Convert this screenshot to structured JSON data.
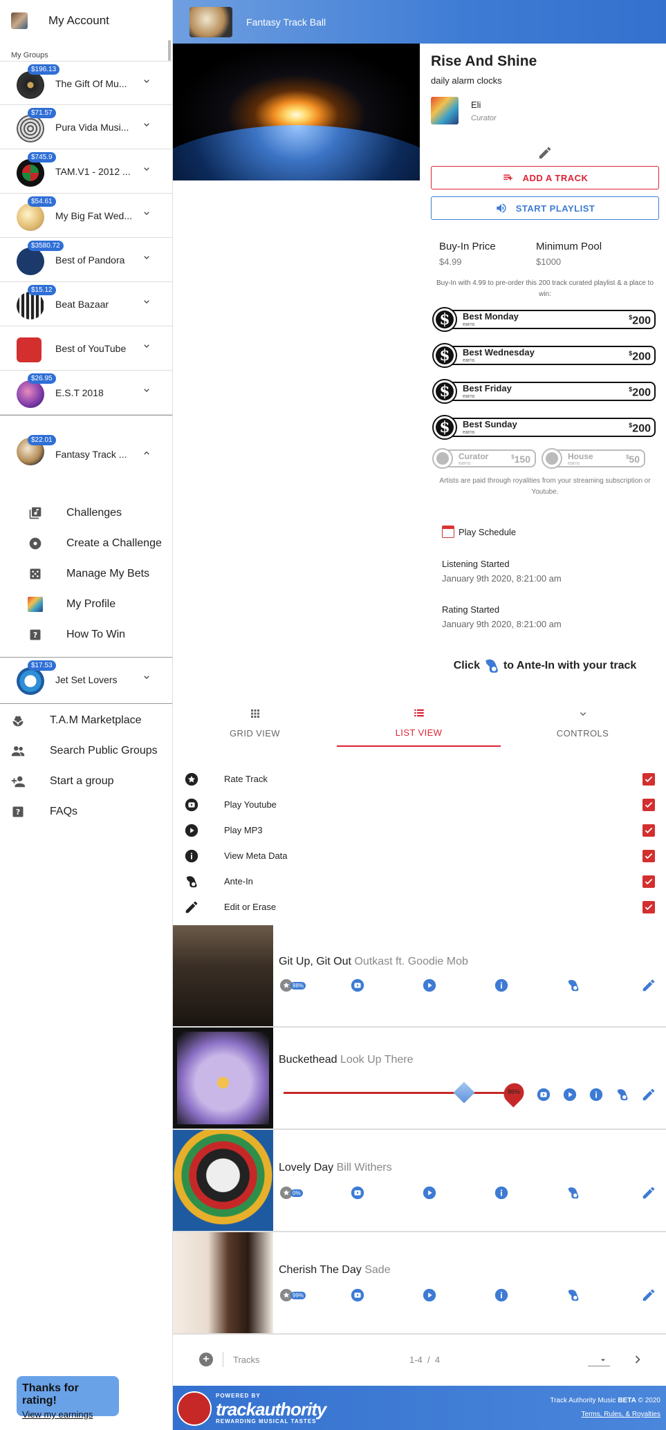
{
  "account": {
    "label": "My Account"
  },
  "sidebar": {
    "groups_heading": "My Groups",
    "groups": [
      {
        "name": "The Gift Of Mu...",
        "badge": "$196.13"
      },
      {
        "name": "Pura Vida Musi...",
        "badge": "$71.57"
      },
      {
        "name": "TAM.V1 - 2012 ...",
        "badge": "$745.9"
      },
      {
        "name": "My Big Fat Wed...",
        "badge": "$54.61"
      },
      {
        "name": "Best of Pandora",
        "badge": "$3580.72"
      },
      {
        "name": "Beat Bazaar",
        "badge": "$15.12"
      },
      {
        "name": "Best of YouTube",
        "badge": ""
      },
      {
        "name": "E.S.T 2018",
        "badge": "$26.95"
      }
    ],
    "open_group": {
      "name": "Fantasy Track ...",
      "badge": "$22.01"
    },
    "submenu": [
      {
        "label": "Challenges",
        "icon": "library-music-icon"
      },
      {
        "label": "Create a Challenge",
        "icon": "disc-icon"
      },
      {
        "label": "Manage My Bets",
        "icon": "dice-icon"
      },
      {
        "label": "My Profile",
        "icon": "profile-photo-icon"
      },
      {
        "label": "How To Win",
        "icon": "help-box-icon"
      }
    ],
    "last_group": {
      "name": "Jet Set Lovers",
      "badge": "$17.53"
    },
    "nav": [
      {
        "label": "T.A.M Marketplace",
        "icon": "marketplace-icon"
      },
      {
        "label": "Search Public Groups",
        "icon": "people-icon"
      },
      {
        "label": "Start a group",
        "icon": "person-add-icon"
      },
      {
        "label": "FAQs",
        "icon": "help-box-icon"
      }
    ],
    "toast": {
      "title": "Thanks for rating!",
      "link": "View my earnings"
    }
  },
  "header": {
    "title": "Fantasy Track Ball"
  },
  "playlist": {
    "title": "Rise And Shine",
    "subtitle": "daily alarm clocks",
    "curator_name": "Eli",
    "curator_role": "Curator",
    "add_track": "ADD A TRACK",
    "start_playlist": "START PLAYLIST",
    "buy_in_label": "Buy-In Price",
    "buy_in_value": "$4.99",
    "min_pool_label": "Minimum Pool",
    "min_pool_value": "$1000",
    "buy_in_text": "Buy-In with 4.99 to pre-order this 200 track curated playlist & a place to win:",
    "prizes": [
      {
        "name": "Best Monday",
        "sub": "earns",
        "amount": "200",
        "currency": "$"
      },
      {
        "name": "Best Wednesday",
        "sub": "earns",
        "amount": "200",
        "currency": "$"
      },
      {
        "name": "Best Friday",
        "sub": "earns",
        "amount": "200",
        "currency": "$"
      },
      {
        "name": "Best Sunday",
        "sub": "earns",
        "amount": "200",
        "currency": "$"
      }
    ],
    "small_prizes": [
      {
        "name": "Curator",
        "sub": "earns",
        "amount": "150",
        "currency": "$"
      },
      {
        "name": "House",
        "sub": "earns",
        "amount": "50",
        "currency": "$"
      }
    ],
    "artists_note": "Artists are paid through royalities from your streaming subscription or Youtube.",
    "schedule_heading": "Play Schedule",
    "listening_label": "Listening Started",
    "listening_date": "January 9th 2020, 8:21:00 am",
    "rating_label": "Rating Started",
    "rating_date": "January 9th 2020, 8:21:00 am",
    "ante_prefix": "Click",
    "ante_suffix": "to Ante-In with your track"
  },
  "tabs": [
    {
      "label": "GRID VIEW",
      "icon": "grid-icon",
      "active": false
    },
    {
      "label": "LIST VIEW",
      "icon": "list-icon",
      "active": true
    },
    {
      "label": "CONTROLS",
      "icon": "chevron-down-icon",
      "active": false
    }
  ],
  "controls": [
    {
      "label": "Rate Track",
      "icon": "star-circle-icon",
      "checked": true
    },
    {
      "label": "Play Youtube",
      "icon": "youtube-icon",
      "checked": true
    },
    {
      "label": "Play MP3",
      "icon": "play-circle-icon",
      "checked": true
    },
    {
      "label": "View Meta Data",
      "icon": "info-icon",
      "checked": true
    },
    {
      "label": "Ante-In",
      "icon": "ante-in-icon",
      "checked": true
    },
    {
      "label": "Edit or Erase",
      "icon": "pencil-icon",
      "checked": true
    }
  ],
  "tracks": [
    {
      "title": "Git Up, Git Out",
      "artist": "Outkast ft. Goodie Mob",
      "rating": "88%"
    },
    {
      "title": "Buckethead",
      "artist": "Look Up There",
      "rating": "86%"
    },
    {
      "title": "Lovely Day",
      "artist": "Bill Withers",
      "rating": "0%"
    },
    {
      "title": "Cherish The Day",
      "artist": "Sade",
      "rating": "99%"
    }
  ],
  "slider_value": 0.86,
  "pager": {
    "label": "Tracks",
    "range": "1-4",
    "sep": "/",
    "total": "4"
  },
  "footer": {
    "powered": "POWERED BY",
    "brand": "trackauthority",
    "tagline": "REWARDING MUSICAL TASTES",
    "copyright": "Track Authority Music",
    "beta": "BETA",
    "year": "© 2020",
    "terms": "Terms, Rules, & Royalties"
  },
  "colors": {
    "accent_red": "#d32f2f",
    "accent_blue": "#3d7bd4",
    "header_blue": "#3d7bd4"
  }
}
